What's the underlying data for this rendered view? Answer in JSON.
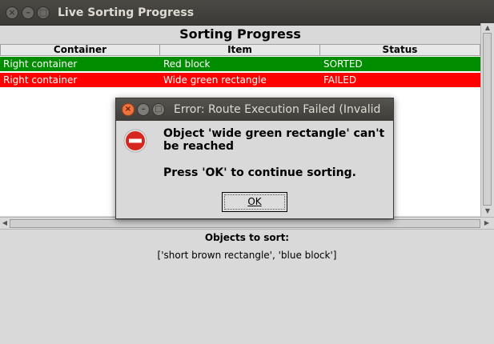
{
  "window": {
    "title": "Live Sorting Progress"
  },
  "heading": "Sorting Progress",
  "table": {
    "columns": [
      "Container",
      "Item",
      "Status"
    ],
    "rows": [
      {
        "container": "Right container",
        "item": "Red block",
        "status": "SORTED",
        "color": "#008d00"
      },
      {
        "container": "Right container",
        "item": "Wide green rectangle",
        "status": "FAILED",
        "color": "#ff0000"
      }
    ]
  },
  "objects": {
    "label": "Objects to sort:",
    "list": "['short brown rectangle', 'blue block']"
  },
  "dialog": {
    "title": "Error: Route Execution Failed (Invalid",
    "message": "Object 'wide green rectangle' can't be reached",
    "instruction": "Press 'OK' to continue sorting.",
    "ok_label": "OK",
    "icon": "error-stop-icon"
  },
  "colors": {
    "sorted": "#008d00",
    "failed": "#ff0000",
    "titlebar": "#3b3a36"
  }
}
